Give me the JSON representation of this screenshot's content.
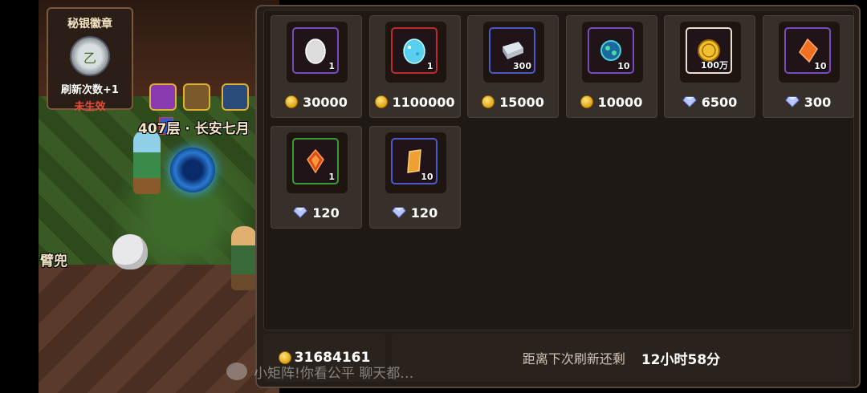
{
  "scene": {
    "floor_label": "407层 · 长安七月",
    "npc_label": "臂兜"
  },
  "badge": {
    "title": "秘银徽章",
    "emblem_glyph": "乙",
    "effect": "刷新次数+1",
    "status": "未生效",
    "status_color": "#e54a3a"
  },
  "shop": {
    "items": [
      {
        "name": "white-egg",
        "qty": "1",
        "price": "30000",
        "currency": "coin",
        "frame_color": "#7a4ac0"
      },
      {
        "name": "blue-egg",
        "qty": "1",
        "price": "1100000",
        "currency": "coin",
        "frame_color": "#c02a2a"
      },
      {
        "name": "silver-ingot",
        "qty": "300",
        "price": "15000",
        "currency": "coin",
        "frame_color": "#4a5ac8"
      },
      {
        "name": "spirit-orb",
        "qty": "10",
        "price": "10000",
        "currency": "coin",
        "frame_color": "#7a4ac0"
      },
      {
        "name": "gold-coin-pack",
        "qty": "100万",
        "price": "6500",
        "currency": "diamond",
        "frame_color": "#e8e0d0"
      },
      {
        "name": "orange-crystal",
        "qty": "10",
        "price": "300",
        "currency": "diamond",
        "frame_color": "#7a4ac0"
      },
      {
        "name": "fire-crystal",
        "qty": "1",
        "price": "120",
        "currency": "diamond",
        "frame_color": "#3a9a3a"
      },
      {
        "name": "gold-shard",
        "qty": "10",
        "price": "120",
        "currency": "diamond",
        "frame_color": "#4a5ac8"
      }
    ]
  },
  "footer": {
    "gold_total": "31684161",
    "refresh_label": "距离下次刷新还剩",
    "refresh_time": "12小时58分"
  },
  "chat": {
    "text": "小矩阵!你看公平 聊天都…"
  }
}
